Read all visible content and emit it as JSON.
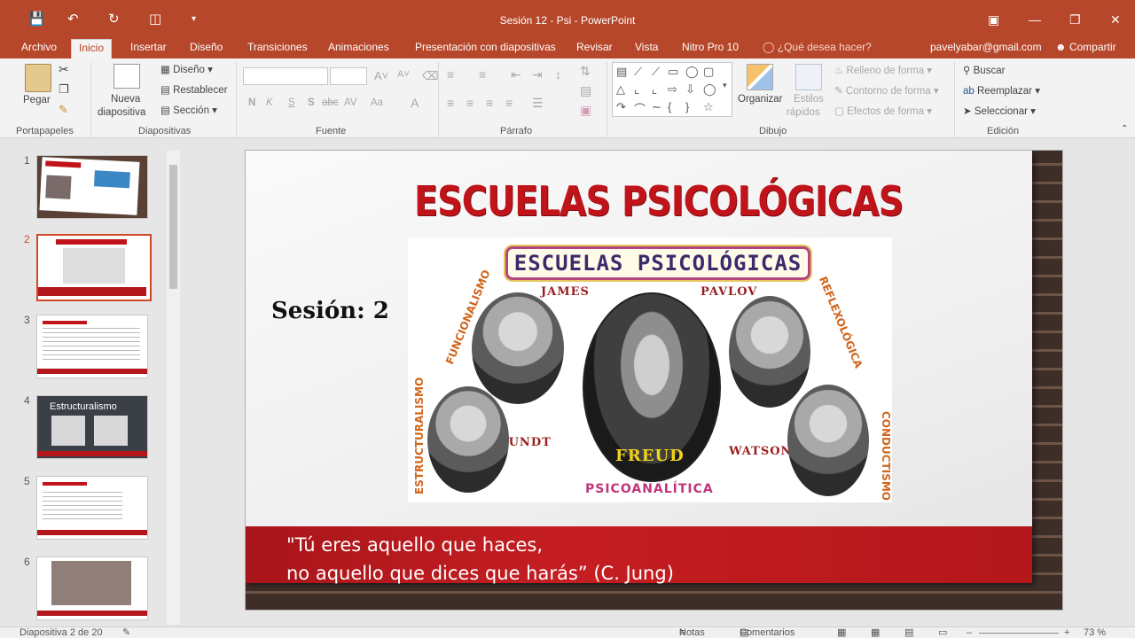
{
  "window": {
    "title": "Sesión 12 - Psi - PowerPoint"
  },
  "tabs": [
    {
      "label": "Archivo"
    },
    {
      "label": "Inicio"
    },
    {
      "label": "Insertar"
    },
    {
      "label": "Diseño"
    },
    {
      "label": "Transiciones"
    },
    {
      "label": "Animaciones"
    },
    {
      "label": "Presentación con diapositivas"
    },
    {
      "label": "Revisar"
    },
    {
      "label": "Vista"
    },
    {
      "label": "Nitro Pro 10"
    }
  ],
  "tell_me": "¿Qué desea hacer?",
  "account": {
    "email": "pavelyabar@gmail.com",
    "share_label": "Compartir"
  },
  "ribbon": {
    "clipboard": {
      "paste": "Pegar",
      "group": "Portapapeles"
    },
    "slides": {
      "new_slide_line1": "Nueva",
      "new_slide_line2": "diapositiva",
      "layout": "Diseño",
      "reset": "Restablecer",
      "section": "Sección",
      "group": "Diapositivas"
    },
    "font": {
      "bold": "N",
      "italic": "K",
      "underline": "S",
      "shadow": "S",
      "strike": "abc",
      "spacing": "AV",
      "case": "Aa",
      "color": "A",
      "group": "Fuente"
    },
    "paragraph": {
      "group": "Párrafo"
    },
    "drawing": {
      "arrange": "Organizar",
      "styles_line1": "Estilos",
      "styles_line2": "rápidos",
      "fill": "Relleno de forma",
      "outline": "Contorno de forma",
      "effects": "Efectos de forma",
      "group": "Dibujo"
    },
    "editing": {
      "find": "Buscar",
      "replace": "Reemplazar",
      "select": "Seleccionar",
      "group": "Edición"
    }
  },
  "thumbnails": [
    {
      "num": "1"
    },
    {
      "num": "2"
    },
    {
      "num": "3"
    },
    {
      "num": "4",
      "title": "Estructuralismo"
    },
    {
      "num": "5"
    },
    {
      "num": "6"
    }
  ],
  "slide": {
    "title": "ESCUELAS PSICOLÓGICAS",
    "session": "Sesión: 2",
    "picture": {
      "banner": "ESCUELAS PSICOLÓGICAS",
      "names": {
        "james": "JAMES",
        "pavlov": "PAVLOV",
        "wundt": "WUNDT",
        "freud": "FREUD",
        "watson": "WATSON"
      },
      "schools": {
        "funcionalismo": "FUNCIONALISMO",
        "reflexologica": "REFLEXOLÓGICA",
        "estructuralismo": "ESTRUCTURALISMO",
        "conductismo": "CONDUCTISMO",
        "psicoanalitica": "PSICOANALÍTICA"
      }
    },
    "quote_line1": "\"Tú eres aquello que haces,",
    "quote_line2": "no aquello que dices que harás” (C. Jung)"
  },
  "status": {
    "slide_counter": "Diapositiva 2 de 20",
    "notes": "Notas",
    "comments": "Comentarios",
    "zoom": "73 %"
  },
  "colors": {
    "accent": "#b7472a",
    "title_red": "#c0141a",
    "band_red": "#b3161b"
  }
}
